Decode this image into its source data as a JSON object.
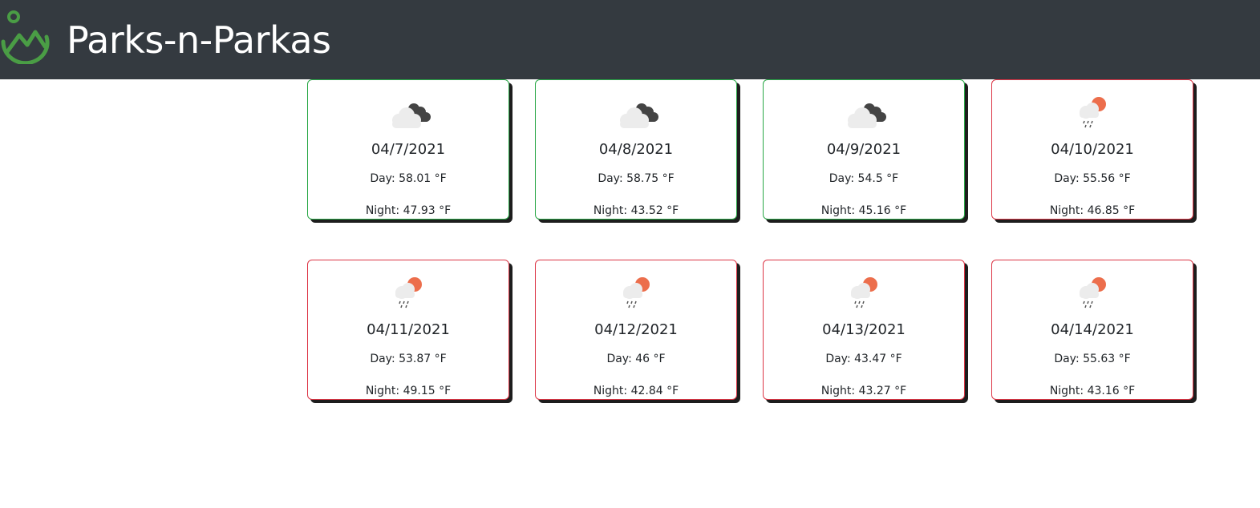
{
  "header": {
    "brand": "Parks-n-Parkas",
    "background": "#343a40",
    "logo_color": "#4a9d45",
    "logo_icon": "mountain-pin-logo-icon"
  },
  "forecast": [
    {
      "date": "04/7/2021",
      "day": "Day: 58.01 °F",
      "night": "Night: 47.93 °F",
      "icon": "broken-clouds-icon",
      "border": "green"
    },
    {
      "date": "04/8/2021",
      "day": "Day: 58.75 °F",
      "night": "Night: 43.52 °F",
      "icon": "broken-clouds-icon",
      "border": "green"
    },
    {
      "date": "04/9/2021",
      "day": "Day: 54.5 °F",
      "night": "Night: 45.16 °F",
      "icon": "broken-clouds-icon",
      "border": "green"
    },
    {
      "date": "04/10/2021",
      "day": "Day: 55.56 °F",
      "night": "Night: 46.85 °F",
      "icon": "sun-rain-icon",
      "border": "red"
    },
    {
      "date": "04/11/2021",
      "day": "Day: 53.87 °F",
      "night": "Night: 49.15 °F",
      "icon": "sun-rain-icon",
      "border": "red"
    },
    {
      "date": "04/12/2021",
      "day": "Day: 46 °F",
      "night": "Night: 42.84 °F",
      "icon": "sun-rain-icon",
      "border": "red"
    },
    {
      "date": "04/13/2021",
      "day": "Day: 43.47 °F",
      "night": "Night: 43.27 °F",
      "icon": "sun-rain-icon",
      "border": "red"
    },
    {
      "date": "04/14/2021",
      "day": "Day: 55.63 °F",
      "night": "Night: 43.16 °F",
      "icon": "sun-rain-icon",
      "border": "red"
    }
  ],
  "colors": {
    "good": "#28a745",
    "bad": "#dc3545",
    "sun": "#ec6e4c",
    "cloud_dark": "#444444",
    "cloud_light": "#e8e8e8"
  }
}
